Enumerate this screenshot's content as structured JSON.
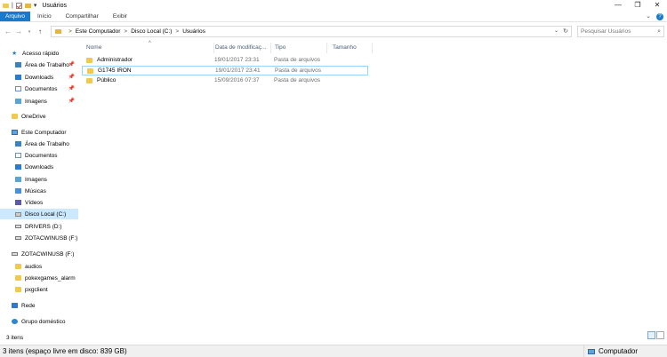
{
  "window": {
    "title": "Usuários",
    "controls": [
      "—",
      "❐",
      "✕"
    ]
  },
  "ribbon": {
    "tabs": [
      "Arquivo",
      "Início",
      "Compartilhar",
      "Exibir"
    ],
    "expand": "⌄",
    "help": "?"
  },
  "address": {
    "crumbs": [
      "Este Computador",
      "Disco Local (C:)",
      "Usuários"
    ],
    "separator": ">",
    "search_placeholder": "Pesquisar Usuários"
  },
  "sidebar": {
    "items": [
      {
        "label": "Acesso rápido",
        "icon": "star-icon",
        "pinned": false
      },
      {
        "label": "Área de Trabalho",
        "icon": "desktop-icon",
        "pinned": true
      },
      {
        "label": "Downloads",
        "icon": "download-icon",
        "pinned": true
      },
      {
        "label": "Documentos",
        "icon": "document-icon",
        "pinned": true
      },
      {
        "label": "Imagens",
        "icon": "pictures-icon",
        "pinned": true
      },
      {
        "label": "OneDrive",
        "icon": "folder-icon"
      },
      {
        "label": "Este Computador",
        "icon": "computer-icon"
      },
      {
        "label": "Área de Trabalho",
        "icon": "desktop-icon"
      },
      {
        "label": "Documentos",
        "icon": "document-icon"
      },
      {
        "label": "Downloads",
        "icon": "download-icon"
      },
      {
        "label": "Imagens",
        "icon": "pictures-icon"
      },
      {
        "label": "Músicas",
        "icon": "music-icon"
      },
      {
        "label": "Vídeos",
        "icon": "video-icon"
      },
      {
        "label": "Disco Local (C:)",
        "icon": "disk-icon",
        "selected": true
      },
      {
        "label": "DRIVERS (D:)",
        "icon": "drive-icon"
      },
      {
        "label": "ZOTACWINUSB (F:)",
        "icon": "usb-icon"
      },
      {
        "label": "ZOTACWINUSB (F:)",
        "icon": "usb-icon"
      },
      {
        "label": "audios",
        "icon": "folder-icon"
      },
      {
        "label": "pokexgames_alarm",
        "icon": "folder-icon"
      },
      {
        "label": "pxgclient",
        "icon": "folder-icon"
      },
      {
        "label": "Rede",
        "icon": "network-icon"
      },
      {
        "label": "Grupo doméstico",
        "icon": "homegroup-icon"
      }
    ]
  },
  "columns": [
    "Nome",
    "Data de modificaç...",
    "Tipo",
    "Tamanho"
  ],
  "rows": [
    {
      "name": "Administrador",
      "date": "19/01/2017 23:31",
      "type": "Pasta de arquivos"
    },
    {
      "name": "G1745 IRON",
      "date": "19/01/2017 23:41",
      "type": "Pasta de arquivos"
    },
    {
      "name": "Público",
      "date": "15/09/2016 07:37",
      "type": "Pasta de arquivos"
    }
  ],
  "status": {
    "item_count": "3 itens",
    "bottom_text": "3 itens (espaço livre em disco: 839 GB)",
    "location": "Computador"
  },
  "colors": {
    "accent": "#1979ca",
    "selection": "#cce8ff",
    "folder": "#f2c94c"
  }
}
